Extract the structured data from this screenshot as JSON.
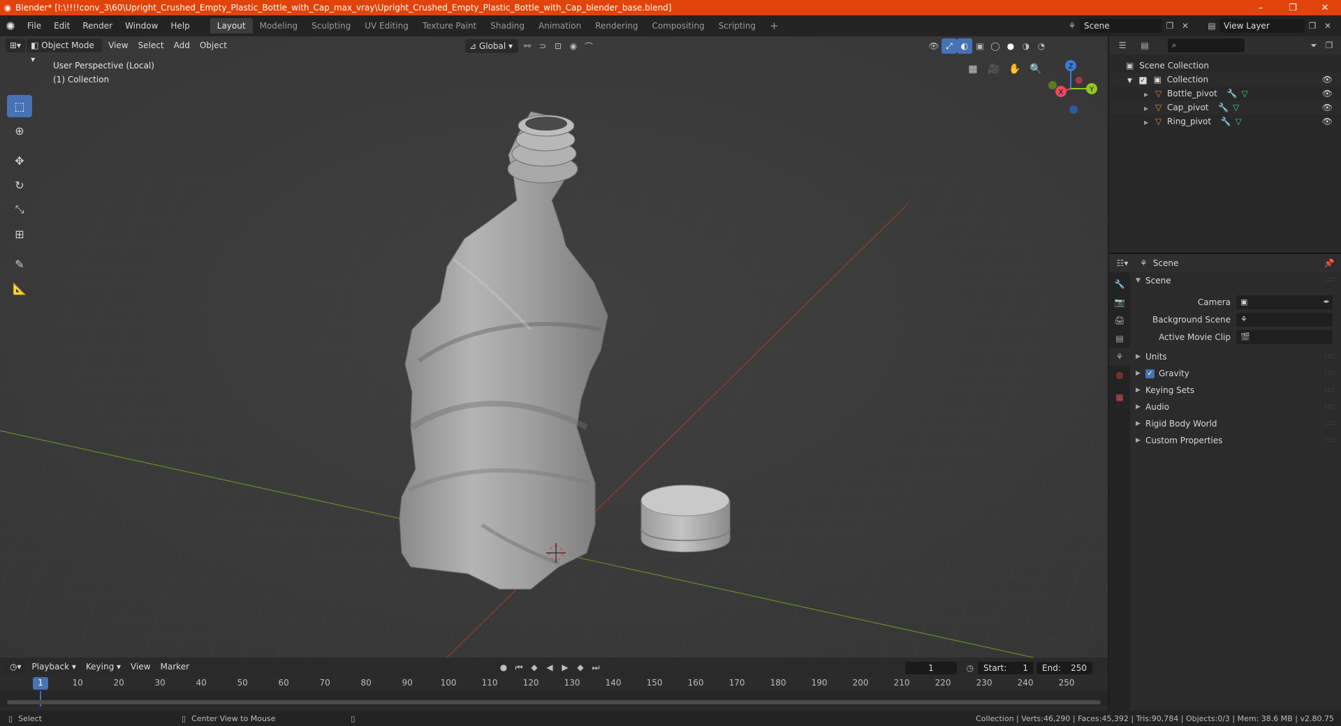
{
  "titlebar": {
    "title": "Blender* [I:\\!!!!conv_3\\60\\Upright_Crushed_Empty_Plastic_Bottle_with_Cap_max_vray\\Upright_Crushed_Empty_Plastic_Bottle_with_Cap_blender_base.blend]",
    "minimize": "–",
    "maximize": "❐",
    "close": "✕"
  },
  "menu": {
    "items": [
      "File",
      "Edit",
      "Render",
      "Window",
      "Help"
    ]
  },
  "workspaces": {
    "tabs": [
      "Layout",
      "Modeling",
      "Sculpting",
      "UV Editing",
      "Texture Paint",
      "Shading",
      "Animation",
      "Rendering",
      "Compositing",
      "Scripting"
    ],
    "add": "+"
  },
  "scene_selector": {
    "value": "Scene"
  },
  "view_layer_selector": {
    "value": "View Layer"
  },
  "viewport": {
    "mode": "Object Mode",
    "menus": [
      "View",
      "Select",
      "Add",
      "Object"
    ],
    "orientation": "Global",
    "info_line1": "User Perspective (Local)",
    "info_line2": "(1) Collection",
    "gizmo": {
      "x": "X",
      "y": "Y",
      "z": "Z"
    }
  },
  "outliner": {
    "scene_collection": "Scene Collection",
    "collection": "Collection",
    "objects": [
      {
        "name": "Bottle_pivot"
      },
      {
        "name": "Cap_pivot"
      },
      {
        "name": "Ring_pivot"
      }
    ]
  },
  "properties": {
    "header": "Scene",
    "panel_title": "Scene",
    "camera_label": "Camera",
    "background_scene_label": "Background Scene",
    "active_movie_clip_label": "Active Movie Clip",
    "subpanels": {
      "units": "Units",
      "gravity": "Gravity",
      "keying_sets": "Keying Sets",
      "audio": "Audio",
      "rigid_body_world": "Rigid Body World",
      "custom_properties": "Custom Properties"
    },
    "gravity_checked": true
  },
  "timeline": {
    "menus": [
      "Playback",
      "Keying",
      "View",
      "Marker"
    ],
    "current_frame": "1",
    "start_label": "Start:",
    "start_value": "1",
    "end_label": "End:",
    "end_value": "250",
    "ruler_labels": [
      "1",
      "10",
      "20",
      "30",
      "40",
      "50",
      "60",
      "70",
      "80",
      "90",
      "100",
      "110",
      "120",
      "130",
      "140",
      "150",
      "160",
      "170",
      "180",
      "190",
      "200",
      "210",
      "220",
      "230",
      "240",
      "250"
    ]
  },
  "statusbar": {
    "select": "Select",
    "center_view": "Center View to Mouse",
    "stats": "Collection | Verts:46,290 | Faces:45,392 | Tris:90,784 | Objects:0/3 | Mem: 38.6 MB | v2.80.75"
  },
  "colors": {
    "accent": "#4772b3",
    "titlebar": "#e2430b",
    "x_axis": "#e84a5f",
    "y_axis": "#8fca1f",
    "z_axis": "#3c7bd6"
  }
}
